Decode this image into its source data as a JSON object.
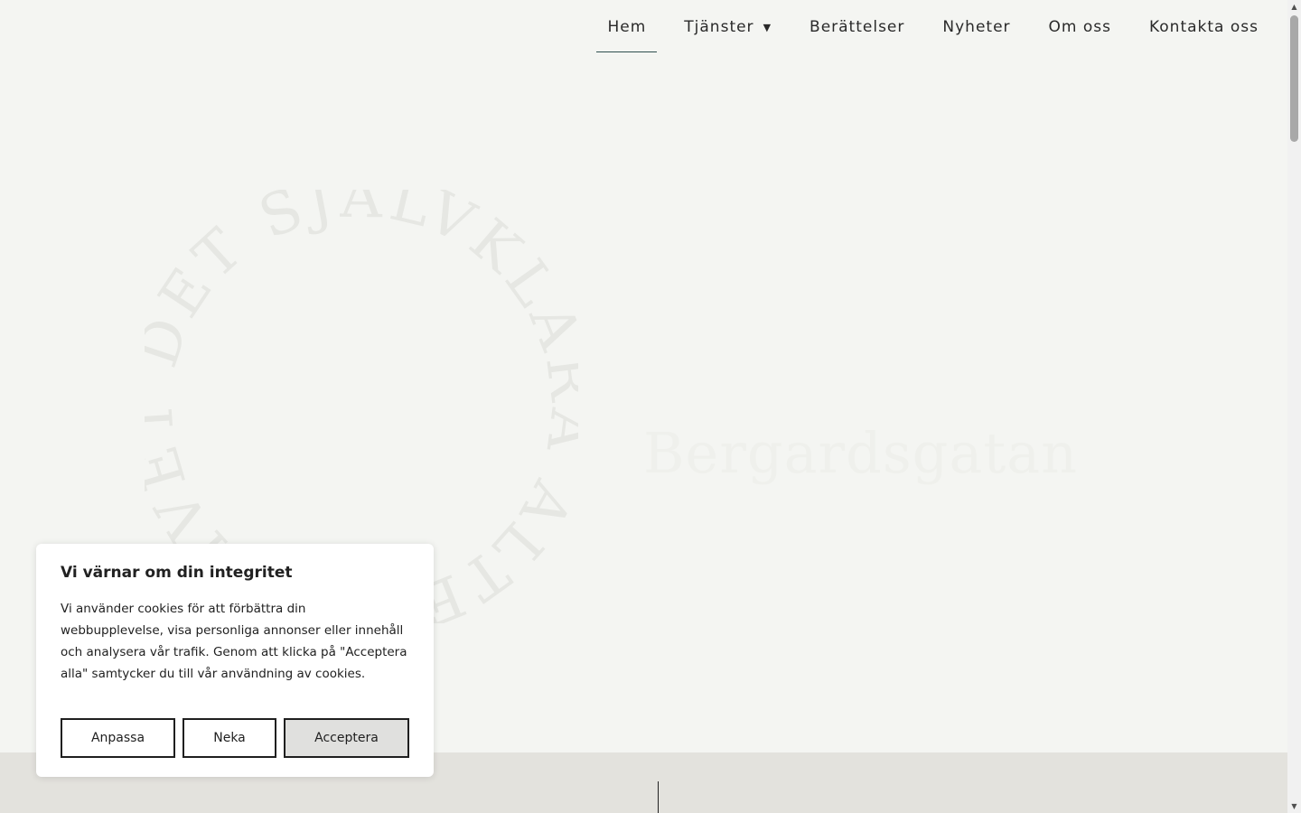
{
  "nav": {
    "items": [
      {
        "label": "Hem",
        "active": true
      },
      {
        "label": "Tjänster",
        "has_dropdown": true
      },
      {
        "label": "Berättelser"
      },
      {
        "label": "Nyheter"
      },
      {
        "label": "Om oss"
      },
      {
        "label": "Kontakta oss"
      }
    ]
  },
  "hero": {
    "circle_text": "DET SJÄLVKLARA ALTERNATIVET.",
    "title": "Bergardsgatan"
  },
  "cookie": {
    "title": "Vi värnar om din integritet",
    "text": "Vi använder cookies för att förbättra din webbupplevelse, visa personliga annonser eller innehåll och analysera vår trafik. Genom att klicka på \"Acceptera alla\" samtycker du till vår användning av cookies.",
    "buttons": {
      "customize": "Anpassa",
      "reject": "Neka",
      "accept": "Acceptera"
    }
  },
  "colors": {
    "background": "#f4f5f2",
    "band": "#e3e2dd",
    "active_underline": "#2f4f4f",
    "circle_text": "#e6e7e3"
  }
}
